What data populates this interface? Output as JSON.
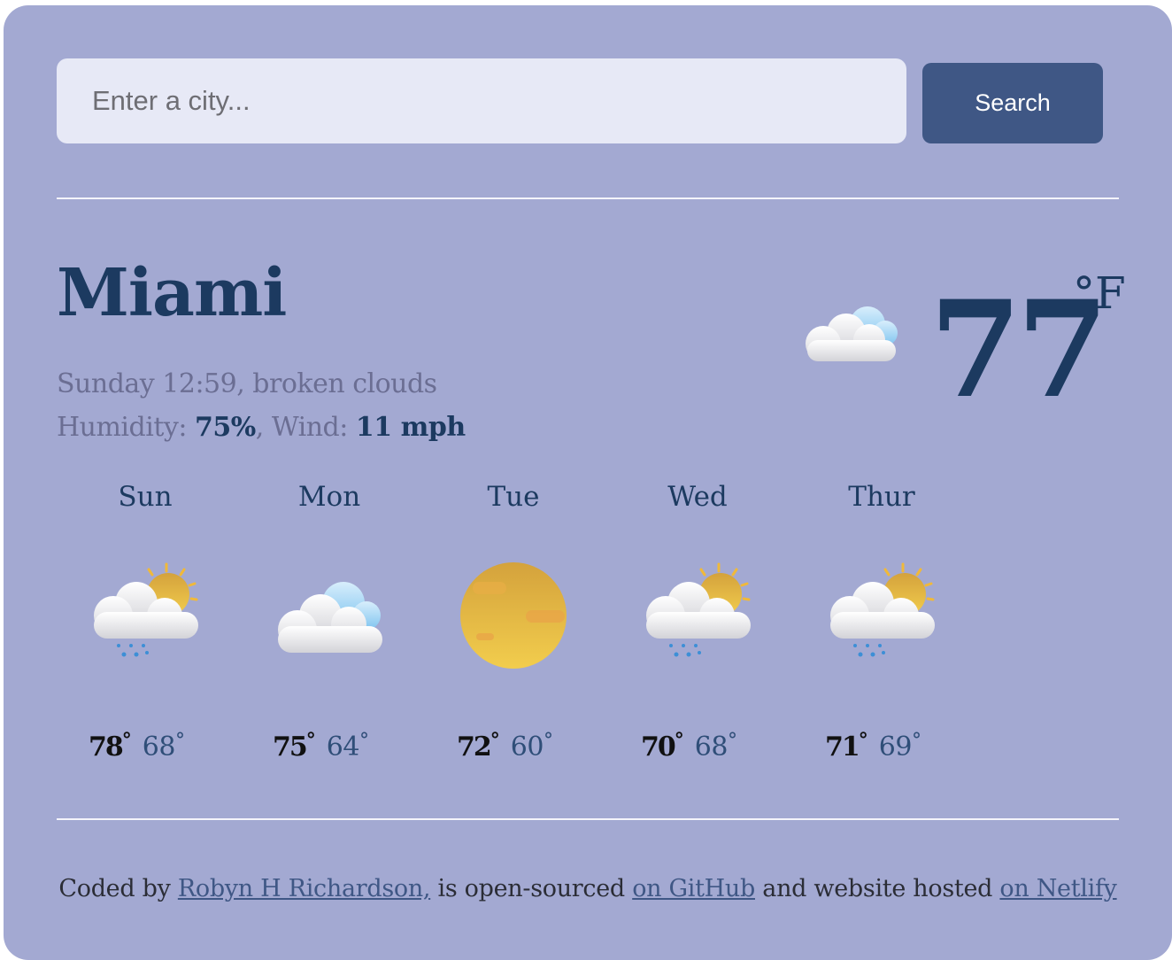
{
  "search": {
    "placeholder": "Enter a city...",
    "button_label": "Search"
  },
  "current": {
    "city": "Miami",
    "day_time_description": "Sunday 12:59, broken clouds",
    "humidity_label": "Humidity: ",
    "humidity_value": "75%",
    "wind_label": ", Wind: ",
    "wind_value": "11 mph",
    "temperature": "77",
    "unit": "°F",
    "icon": "cloud-icon"
  },
  "forecast": [
    {
      "day": "Sun",
      "max": "78",
      "min": "68",
      "deg": "°",
      "icon": "sun-cloud-rain-icon"
    },
    {
      "day": "Mon",
      "max": "75",
      "min": "64",
      "deg": "°",
      "icon": "cloud-icon"
    },
    {
      "day": "Tue",
      "max": "72",
      "min": "60",
      "deg": "°",
      "icon": "sun-icon"
    },
    {
      "day": "Wed",
      "max": "70",
      "min": "68",
      "deg": "°",
      "icon": "sun-cloud-rain-icon"
    },
    {
      "day": "Thur",
      "max": "71",
      "min": "69",
      "deg": "°",
      "icon": "sun-cloud-rain-icon"
    }
  ],
  "footer": {
    "text_1": "Coded by ",
    "author_link": "Robyn H Richardson,",
    "text_2": " is open-sourced ",
    "github_link": "on GitHub",
    "text_3": " and website hosted ",
    "netlify_link": "on Netlify"
  },
  "colors": {
    "background": "#a3a9d2",
    "accent": "#3f5785",
    "primary_text": "#1c3a60",
    "muted_text": "#6b6e93"
  }
}
